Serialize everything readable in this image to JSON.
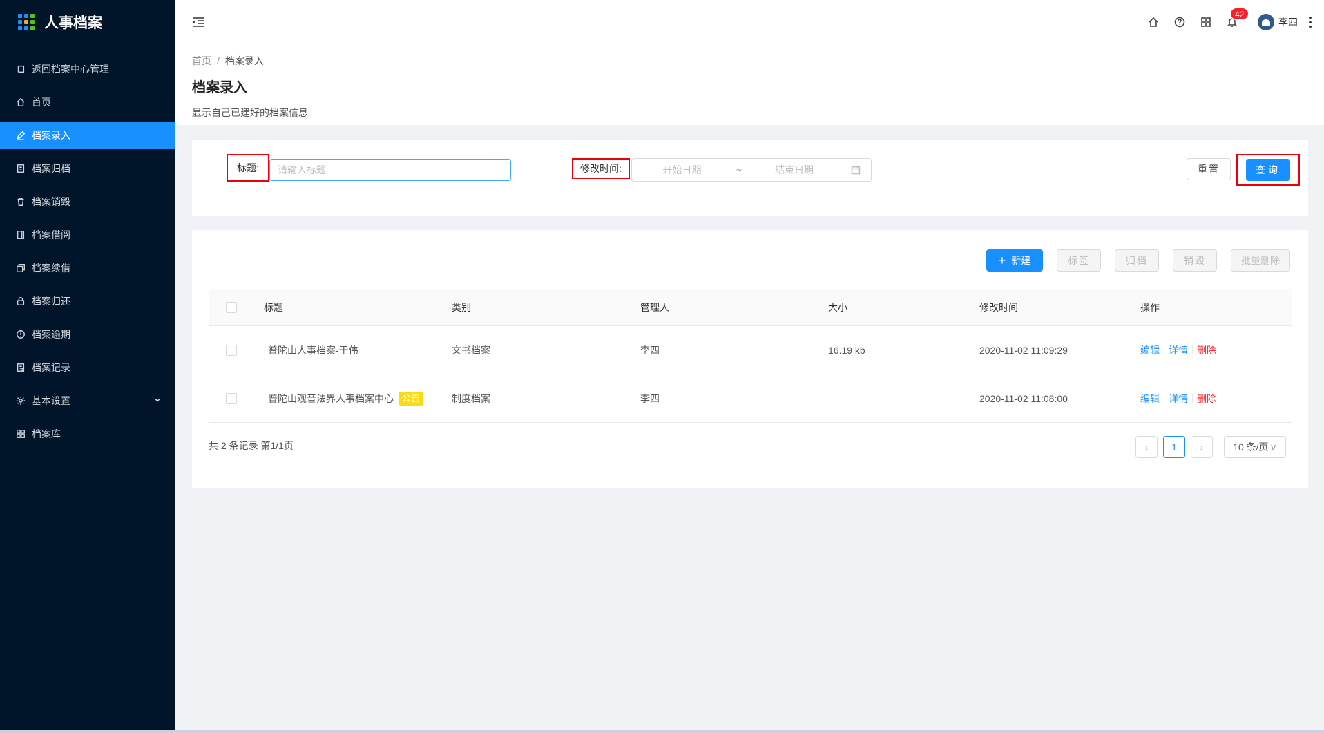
{
  "app": {
    "title": "人事档案"
  },
  "sidebar": {
    "items": [
      {
        "label": "返回档案中心管理",
        "icon": "return-icon"
      },
      {
        "label": "首页",
        "icon": "home-icon"
      },
      {
        "label": "档案录入",
        "icon": "edit-icon",
        "active": true
      },
      {
        "label": "档案归档",
        "icon": "archive-icon"
      },
      {
        "label": "档案销毁",
        "icon": "trash-icon"
      },
      {
        "label": "档案借阅",
        "icon": "book-icon"
      },
      {
        "label": "档案续借",
        "icon": "copy-icon"
      },
      {
        "label": "档案归还",
        "icon": "lock-icon"
      },
      {
        "label": "档案逾期",
        "icon": "warning-icon"
      },
      {
        "label": "档案记录",
        "icon": "record-icon"
      },
      {
        "label": "基本设置",
        "icon": "gear-icon",
        "has_submenu": true
      },
      {
        "label": "档案库",
        "icon": "grid-icon"
      }
    ]
  },
  "header": {
    "notification_count": "42",
    "username": "李四"
  },
  "page": {
    "breadcrumb": [
      "首页",
      "/",
      "档案录入"
    ],
    "title": "档案录入",
    "description": "显示自己已建好的档案信息"
  },
  "search": {
    "title_label": "标题:",
    "title_placeholder": "请输入标题",
    "time_label": "修改时间:",
    "start_placeholder": "开始日期",
    "tilde": "~",
    "end_placeholder": "结束日期",
    "reset_label": "重置",
    "query_label": "查询"
  },
  "toolbar": {
    "new_label": "新建",
    "new_plus": "+",
    "tag_label": "标签",
    "archive_label": "归档",
    "destroy_label": "销毁",
    "batch_delete_label": "批量删除"
  },
  "table": {
    "columns": [
      "标题",
      "类别",
      "管理人",
      "大小",
      "修改时间",
      "操作"
    ],
    "rows": [
      {
        "title": "普陀山人事档案-于伟",
        "tag": "",
        "type": "文书档案",
        "owner": "李四",
        "size": "16.19 kb",
        "time": "2020-11-02 11:09:29"
      },
      {
        "title": "普陀山观音法界人事档案中心",
        "tag": "公告",
        "type": "制度档案",
        "owner": "李四",
        "size": "",
        "time": "2020-11-02 11:08:00"
      }
    ],
    "ops": {
      "edit": "编辑",
      "detail": "详情",
      "delete": "删除"
    }
  },
  "pagination": {
    "summary": "共 2 条记录 第1/1页",
    "prev": "‹",
    "current": "1",
    "next": "›",
    "page_size": "10 条/页",
    "chevron": "∨"
  },
  "colors": {
    "primary": "#1890ff",
    "sidebar_bg": "#001529",
    "danger": "#f5222d",
    "tag": "#fadb14",
    "highlight_border": "#e8000b"
  }
}
